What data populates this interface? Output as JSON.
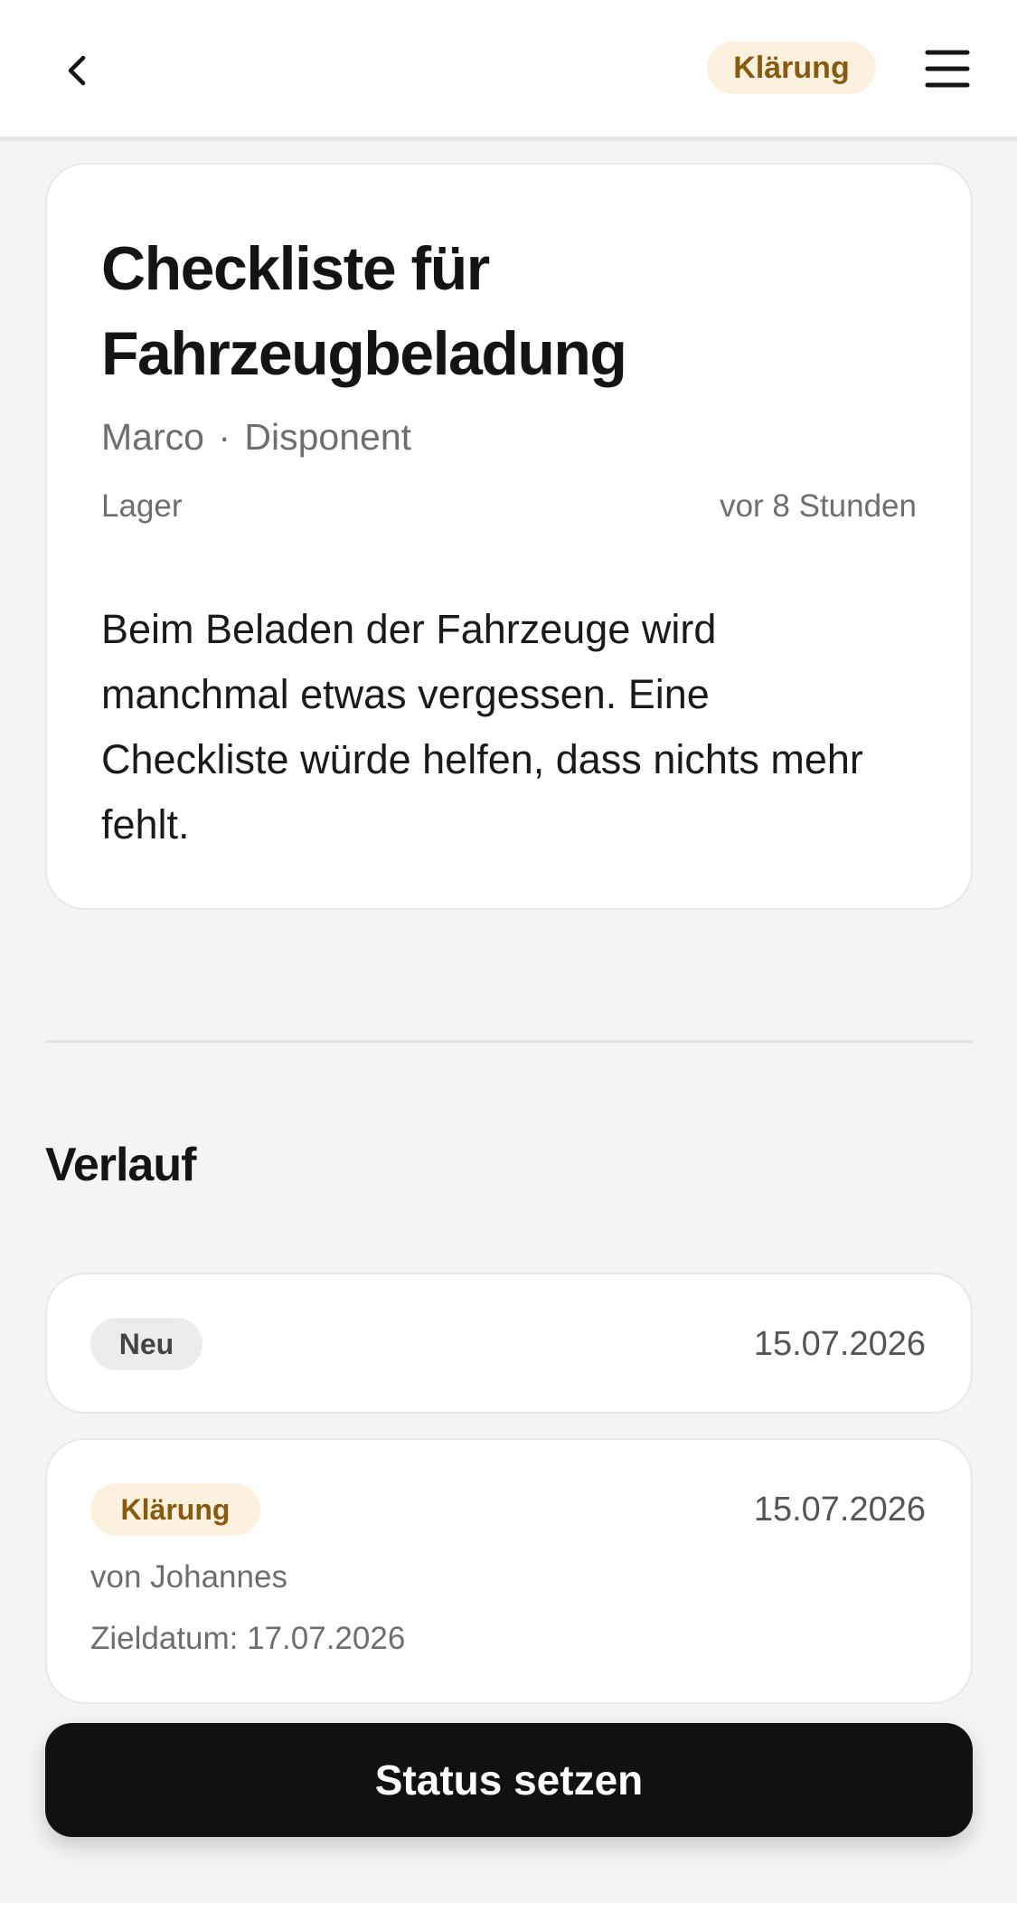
{
  "header": {
    "back_icon": "chevron-left-icon",
    "status_label": "Klärung",
    "menu_icon": "hamburger-menu-icon"
  },
  "idea": {
    "title": "Checkliste für Fahrzeugbeladung",
    "author_name": "Marco",
    "separator": "·",
    "author_role": "Disponent",
    "department": "Lager",
    "time_ago": "vor 8 Stunden",
    "description": "Beim Beladen der Fahrzeuge wird manchmal etwas vergessen. Eine Checkliste würde helfen, dass nichts mehr fehlt."
  },
  "history": {
    "title": "Verlauf",
    "entries": [
      {
        "status": "Neu",
        "date": "15.07.2026"
      },
      {
        "status": "Klärung",
        "date": "15.07.2026",
        "by": "von Johannes",
        "due": "Zieldatum: 17.07.2026"
      }
    ]
  },
  "action": {
    "label": "Status setzen"
  },
  "colors": {
    "clarify_bg": "#fcf1de",
    "clarify_text": "#8a5a0c",
    "new_bg": "#ececec",
    "button_bg": "#111111",
    "page_bg": "#f4f4f4"
  }
}
